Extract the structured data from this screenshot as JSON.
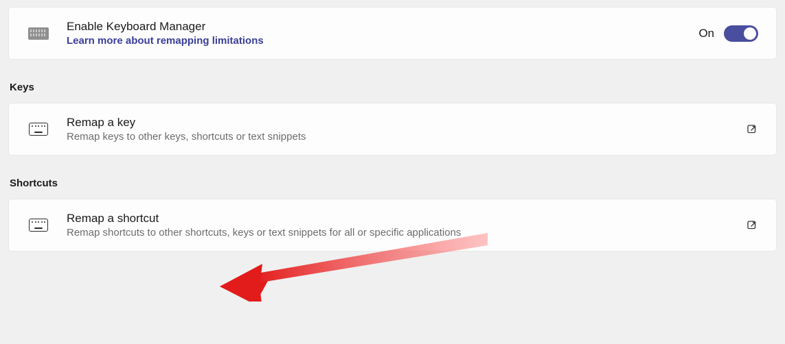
{
  "enable_card": {
    "title": "Enable Keyboard Manager",
    "link_text": "Learn more about remapping limitations",
    "toggle_label": "On",
    "toggle_on": true
  },
  "sections": {
    "keys": {
      "heading": "Keys",
      "item": {
        "title": "Remap a key",
        "subtitle": "Remap keys to other keys, shortcuts or text snippets"
      }
    },
    "shortcuts": {
      "heading": "Shortcuts",
      "item": {
        "title": "Remap a shortcut",
        "subtitle": "Remap shortcuts to other shortcuts, keys or text snippets for all or specific applications"
      }
    }
  }
}
